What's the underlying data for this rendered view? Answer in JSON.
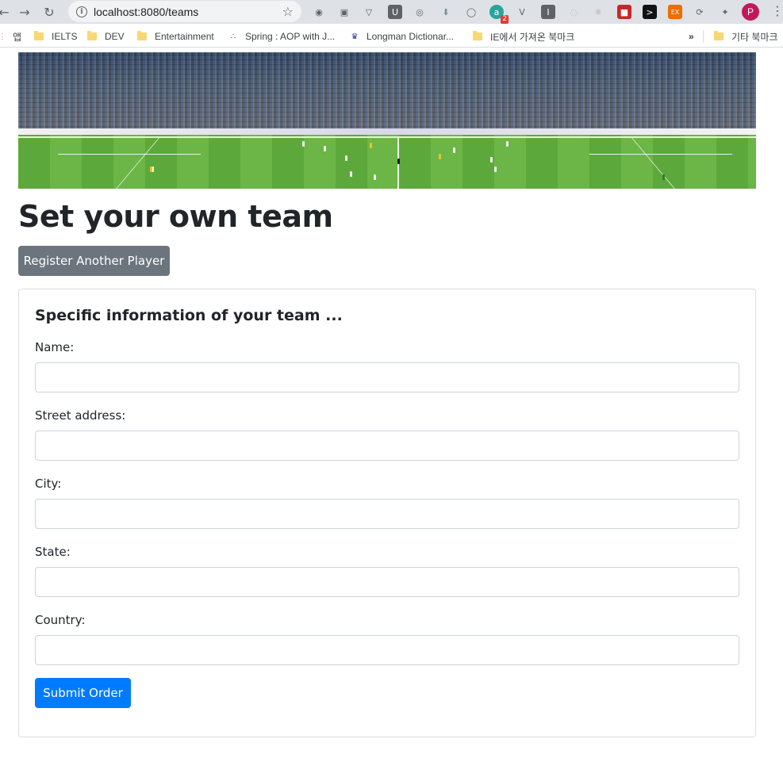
{
  "browser": {
    "url": "localhost:8080/teams",
    "profile_initial": "P",
    "extension_badge_count": "2",
    "icons": [
      "back-icon",
      "forward-icon",
      "reload-icon",
      "info-icon",
      "star-icon",
      "extensions-icon",
      "menu-icon"
    ]
  },
  "bookmarks": {
    "items": [
      {
        "label": "앱",
        "icon": "apps-icon"
      },
      {
        "label": "IELTS",
        "icon": "folder-icon"
      },
      {
        "label": "DEV",
        "icon": "folder-icon"
      },
      {
        "label": "Entertainment",
        "icon": "folder-icon"
      },
      {
        "label": "Spring : AOP with J...",
        "icon": "spring-icon"
      },
      {
        "label": "Longman Dictionar...",
        "icon": "longman-icon"
      },
      {
        "label": "IE에서 가져온 북마크",
        "icon": "folder-icon"
      }
    ],
    "overflow": "»",
    "other_label": "기타 북마크"
  },
  "page": {
    "title": "Set your own team",
    "register_button": "Register Another Player",
    "card": {
      "title": "Specific information of your team ...",
      "fields": [
        {
          "label": "Name:",
          "value": "",
          "placeholder": ""
        },
        {
          "label": "Street address:",
          "value": "",
          "placeholder": ""
        },
        {
          "label": "City:",
          "value": "",
          "placeholder": ""
        },
        {
          "label": "State:",
          "value": "",
          "placeholder": ""
        },
        {
          "label": "Country:",
          "value": "",
          "placeholder": ""
        }
      ],
      "submit_button": "Submit Order"
    }
  },
  "colors": {
    "primary": "#007bff",
    "secondary": "#6c757d",
    "text": "#212529",
    "input_border": "#ced4da"
  }
}
